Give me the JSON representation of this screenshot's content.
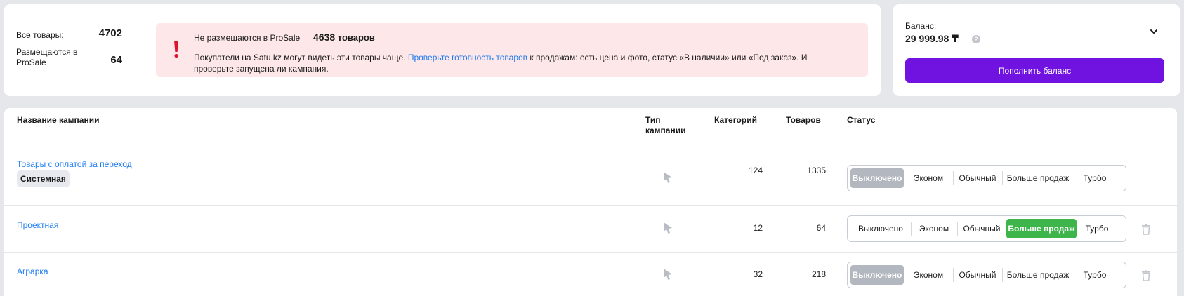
{
  "stats": {
    "all_label": "Все товары:",
    "all_value": "4702",
    "placed_label_line1": "Размещаются в",
    "placed_label_line2": "ProSale",
    "placed_value": "64"
  },
  "alert": {
    "title": "Не размещаются в ProSale",
    "count_number": "4638",
    "count_suffix": "товаров",
    "text_before": "Покупатели на Satu.kz могут видеть эти товары чаще.",
    "link": "Проверьте готовность товаров",
    "text_after": "к продажам: есть цена и фото, статус «В наличии» или «Под заказ». И проверьте запущена ли кампания."
  },
  "balance": {
    "label": "Баланс:",
    "value": "29 999.98 ₸",
    "help": "?",
    "topup_label": "Пополнить баланс"
  },
  "table": {
    "headers": {
      "name": "Название кампании",
      "type_line1": "Тип",
      "type_line2": "кампании",
      "categories": "Категорий",
      "products": "Товаров",
      "status": "Статус"
    },
    "status_options": [
      "Выключено",
      "Эконом",
      "Обычный",
      "Больше продаж",
      "Турбо"
    ],
    "rows": [
      {
        "name": "Товары с оплатой за переход",
        "badge": "Системная",
        "categories": "124",
        "products": "1335",
        "active": "Выключено"
      },
      {
        "name": "Проектная",
        "categories": "12",
        "products": "64",
        "active": "Больше продаж"
      },
      {
        "name": "Аграрка",
        "categories": "32",
        "products": "218",
        "active": "Выключено"
      }
    ]
  },
  "colors": {
    "accent": "#7012e0",
    "link": "#1d7bf2",
    "alert_bg": "#fde7e8",
    "alert_icon": "#e0112b",
    "status_green": "#3db54a",
    "status_grey": "#b3b7bf"
  }
}
